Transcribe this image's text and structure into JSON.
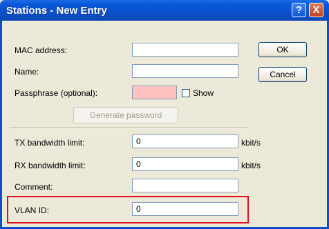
{
  "window": {
    "title": "Stations - New Entry",
    "help_glyph": "?",
    "close_glyph": "X"
  },
  "form": {
    "mac_label": "MAC address:",
    "mac_value": "",
    "name_label": "Name:",
    "name_value": "",
    "passphrase_label": "Passphrase (optional):",
    "passphrase_value": "",
    "show_label": "Show",
    "show_checked": false,
    "generate_label": "Generate password",
    "tx_label": "TX bandwidth limit:",
    "tx_value": "0",
    "tx_unit": "kbit/s",
    "rx_label": "RX bandwidth limit:",
    "rx_value": "0",
    "rx_unit": "kbit/s",
    "comment_label": "Comment:",
    "comment_value": "",
    "vlan_label": "VLAN ID:",
    "vlan_value": "0"
  },
  "buttons": {
    "ok_label": "OK",
    "cancel_label": "Cancel"
  },
  "colors": {
    "titlebar": "#0b50c8",
    "passphrase_bg": "#ffc0c0",
    "highlight": "#e0101a"
  }
}
